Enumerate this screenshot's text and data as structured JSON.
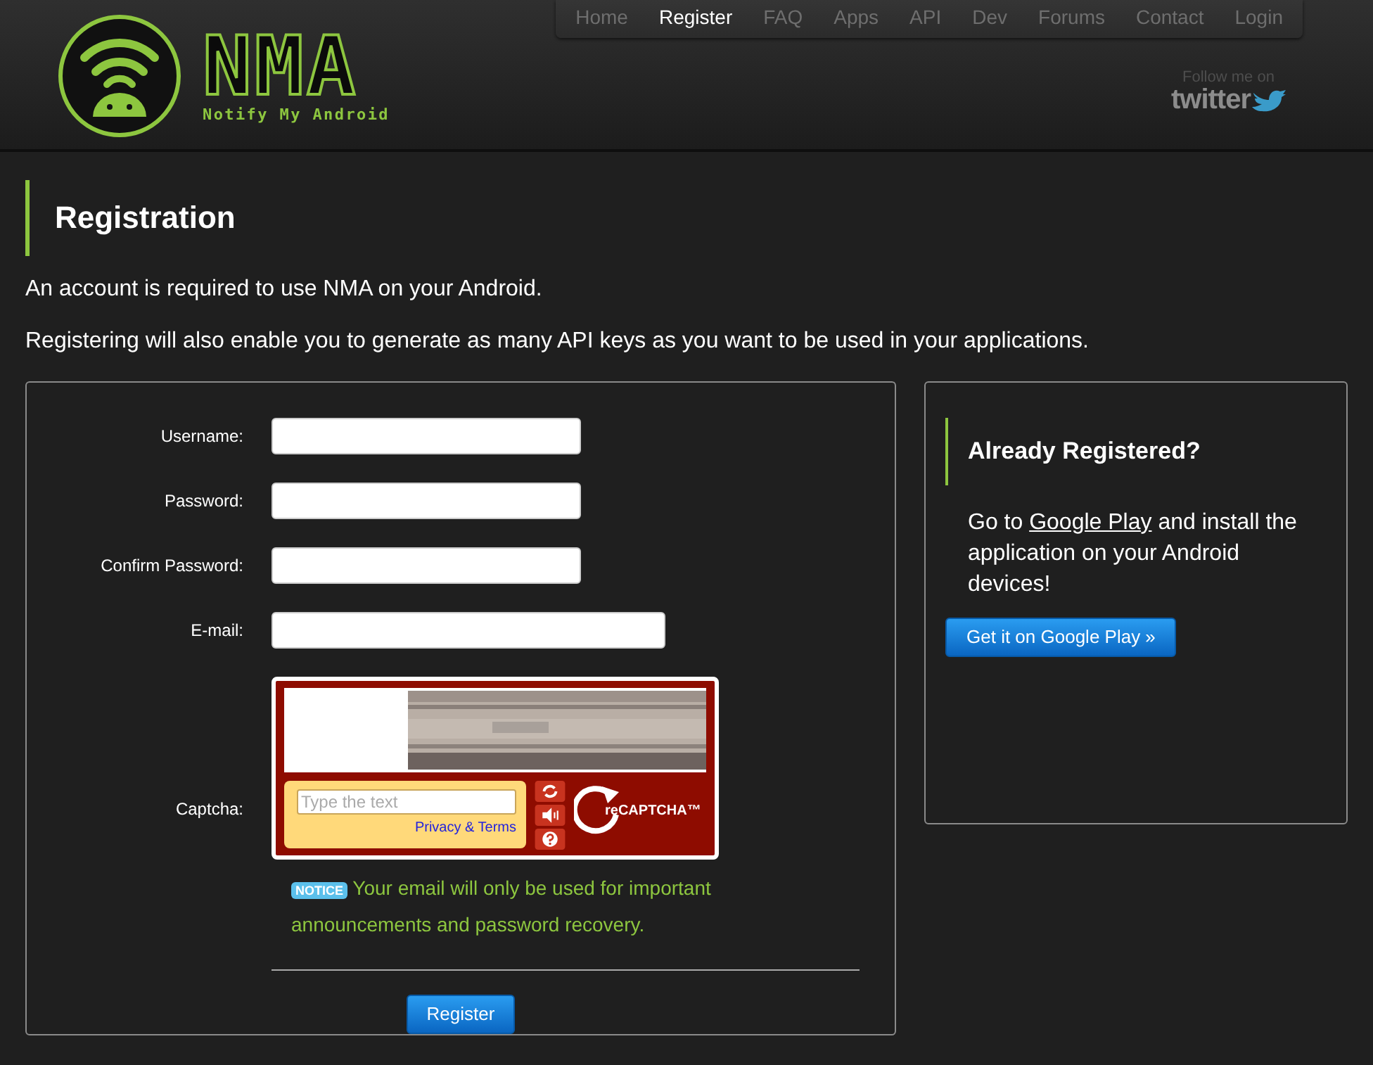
{
  "header": {
    "logo_title": "NMA",
    "logo_subtitle": "Notify My Android",
    "follow_text": "Follow me on",
    "twitter_text": "twitter"
  },
  "nav": [
    {
      "label": "Home",
      "selected": false
    },
    {
      "label": "Register",
      "selected": true
    },
    {
      "label": "FAQ",
      "selected": false
    },
    {
      "label": "Apps",
      "selected": false
    },
    {
      "label": "API",
      "selected": false
    },
    {
      "label": "Dev",
      "selected": false
    },
    {
      "label": "Forums",
      "selected": false
    },
    {
      "label": "Contact",
      "selected": false
    },
    {
      "label": "Login",
      "selected": false
    }
  ],
  "page": {
    "title": "Registration",
    "intro": [
      "An account is required to use NMA on your Android.",
      "Registering will also enable you to generate as many API keys as you want to be used in your applications."
    ]
  },
  "form": {
    "fields": [
      {
        "label": "Username:",
        "kind": "text"
      },
      {
        "label": "Password:",
        "kind": "password"
      },
      {
        "label": "Confirm Password:",
        "kind": "password"
      },
      {
        "label": "E-mail:",
        "kind": "email"
      }
    ],
    "captcha": {
      "label": "Captcha:",
      "placeholder": "Type the text",
      "privacy_link": "Privacy & Terms",
      "brand": "reCAPTCHA™"
    },
    "notice": {
      "badge": "NOTICE",
      "text": "Your email will only be used for important announcements and password recovery."
    },
    "submit": "Register"
  },
  "sidebar": {
    "title": "Already Registered?",
    "text_before": "Go to ",
    "link": "Google Play",
    "text_after": " and install the application on your Android devices!",
    "button": "Get it on Google Play »"
  }
}
